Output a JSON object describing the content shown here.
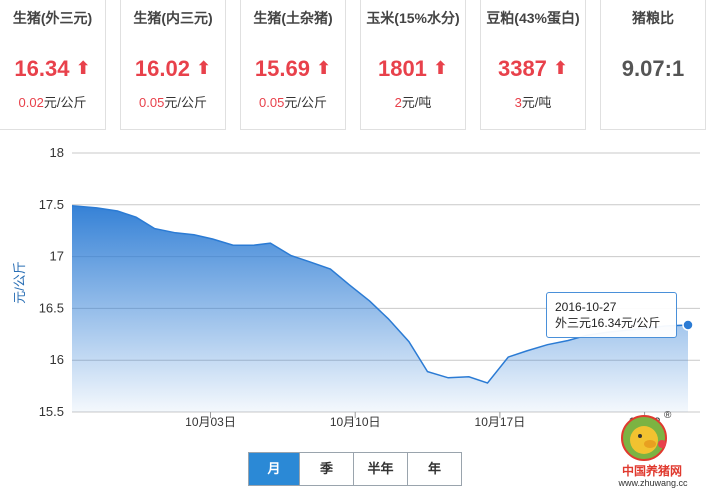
{
  "cards": [
    {
      "name": "生猪(外三元)",
      "price": "16.34",
      "change_num": "0.02",
      "change_unit": "元/公斤"
    },
    {
      "name": "生猪(内三元)",
      "price": "16.02",
      "change_num": "0.05",
      "change_unit": "元/公斤"
    },
    {
      "name": "生猪(土杂猪)",
      "price": "15.69",
      "change_num": "0.05",
      "change_unit": "元/公斤"
    },
    {
      "name": "玉米(15%水分)",
      "price": "1801",
      "change_num": "2",
      "change_unit": "元/吨"
    },
    {
      "name": "豆粕(43%蛋白)",
      "price": "3387",
      "change_num": "3",
      "change_unit": "元/吨"
    }
  ],
  "ratio_card": {
    "name": "猪粮比",
    "value": "9.07:1"
  },
  "up_arrow": "⬆",
  "tooltip": {
    "date": "2016-10-27",
    "text": "外三元16.34元/公斤"
  },
  "periods": [
    {
      "label": "月",
      "active": true
    },
    {
      "label": "季",
      "active": false
    },
    {
      "label": "半年",
      "active": false
    },
    {
      "label": "年",
      "active": false
    }
  ],
  "logo": {
    "brand": "中国养猪网",
    "url": "www.zhuwang.cc",
    "reg": "®"
  },
  "colors": {
    "line": "#2b7bd4",
    "up": "#e8414b",
    "active_btn": "#2b89d6"
  },
  "chart_data": {
    "type": "area",
    "ylabel": "元/公斤",
    "ylim": [
      15.5,
      18
    ],
    "yticks": [
      15.5,
      16,
      16.5,
      17,
      17.5,
      18
    ],
    "xticks": [
      {
        "day": 3,
        "label": "10月03日"
      },
      {
        "day": 10,
        "label": "10月10日"
      },
      {
        "day": 17,
        "label": "10月17日"
      },
      {
        "day": 24,
        "label": "10月2"
      }
    ],
    "grid": true,
    "series": [
      {
        "values": [
          [
            -3.7,
            17.49
          ],
          [
            -2.5,
            17.47
          ],
          [
            -1.5,
            17.44
          ],
          [
            -0.6,
            17.38
          ],
          [
            0.3,
            17.27
          ],
          [
            1.3,
            17.23
          ],
          [
            2.2,
            17.21
          ],
          [
            3.1,
            17.17
          ],
          [
            4.1,
            17.11
          ],
          [
            5.1,
            17.11
          ],
          [
            5.9,
            17.13
          ],
          [
            6.9,
            17.01
          ],
          [
            7.8,
            16.95
          ],
          [
            8.8,
            16.88
          ],
          [
            9.7,
            16.73
          ],
          [
            10.7,
            16.57
          ],
          [
            11.6,
            16.4
          ],
          [
            12.6,
            16.18
          ],
          [
            13.5,
            15.89
          ],
          [
            14.5,
            15.83
          ],
          [
            15.5,
            15.84
          ],
          [
            16.4,
            15.78
          ],
          [
            17.4,
            16.03
          ],
          [
            18.3,
            16.09
          ],
          [
            19.3,
            16.15
          ],
          [
            20.3,
            16.19
          ],
          [
            21.2,
            16.24
          ],
          [
            22.2,
            16.27
          ],
          [
            23.1,
            16.29
          ],
          [
            24.1,
            16.31
          ],
          [
            25.0,
            16.33
          ],
          [
            26.1,
            16.34
          ]
        ]
      }
    ]
  }
}
